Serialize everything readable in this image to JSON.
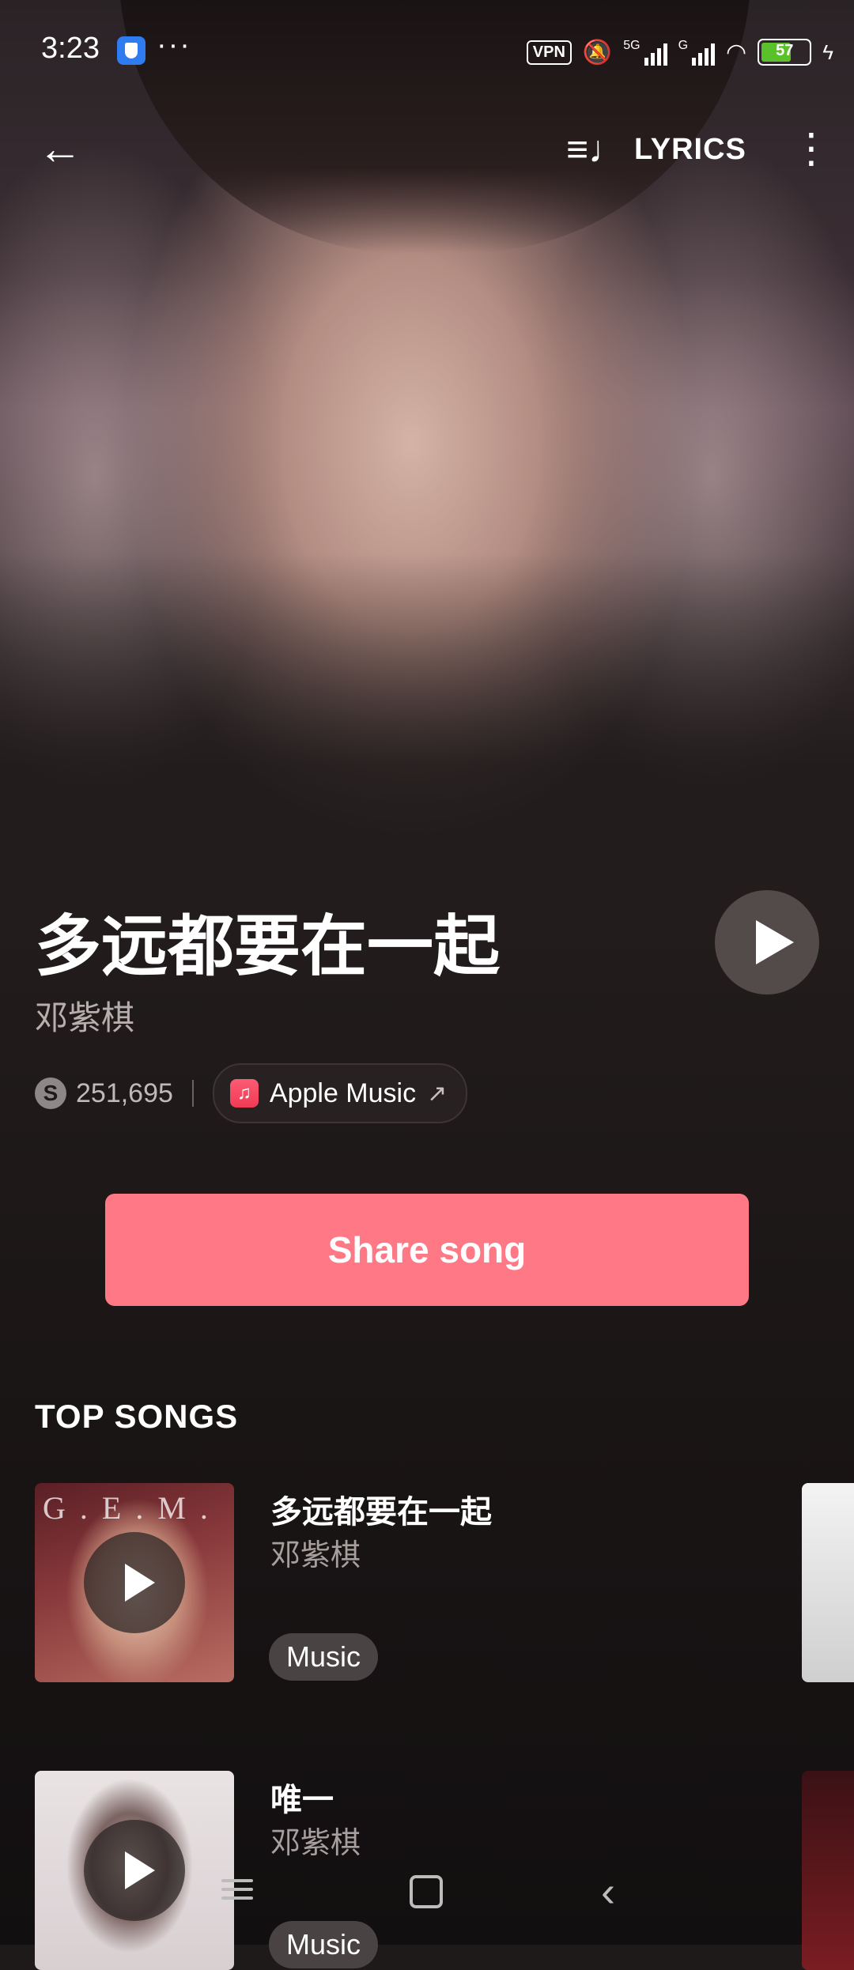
{
  "status_bar": {
    "time": "3:23",
    "vpn": "VPN",
    "signal1_label": "5G",
    "signal2_label": "G",
    "battery": "57"
  },
  "top_nav": {
    "lyrics_label": "LYRICS"
  },
  "song": {
    "title": "多远都要在一起",
    "artist": "邓紫棋",
    "shazam_count": "251,695",
    "apple_music_label": "Apple Music",
    "share_label": "Share song"
  },
  "top_songs": {
    "heading": "TOP SONGS",
    "items": [
      {
        "title": "多远都要在一起",
        "artist": "邓紫棋",
        "badge": "Music",
        "art_text": "G.E.M."
      },
      {
        "title": "唯一",
        "artist": "邓紫棋",
        "badge": "Music"
      }
    ]
  },
  "colors": {
    "share_button": "#ff7886",
    "background": "#1f1a1a"
  },
  "icons": {
    "back": "arrow-left-icon",
    "lyrics": "lyrics-icon",
    "more": "more-vertical-icon",
    "play": "play-icon",
    "shazam": "shazam-icon",
    "apple_music": "apple-music-icon"
  }
}
